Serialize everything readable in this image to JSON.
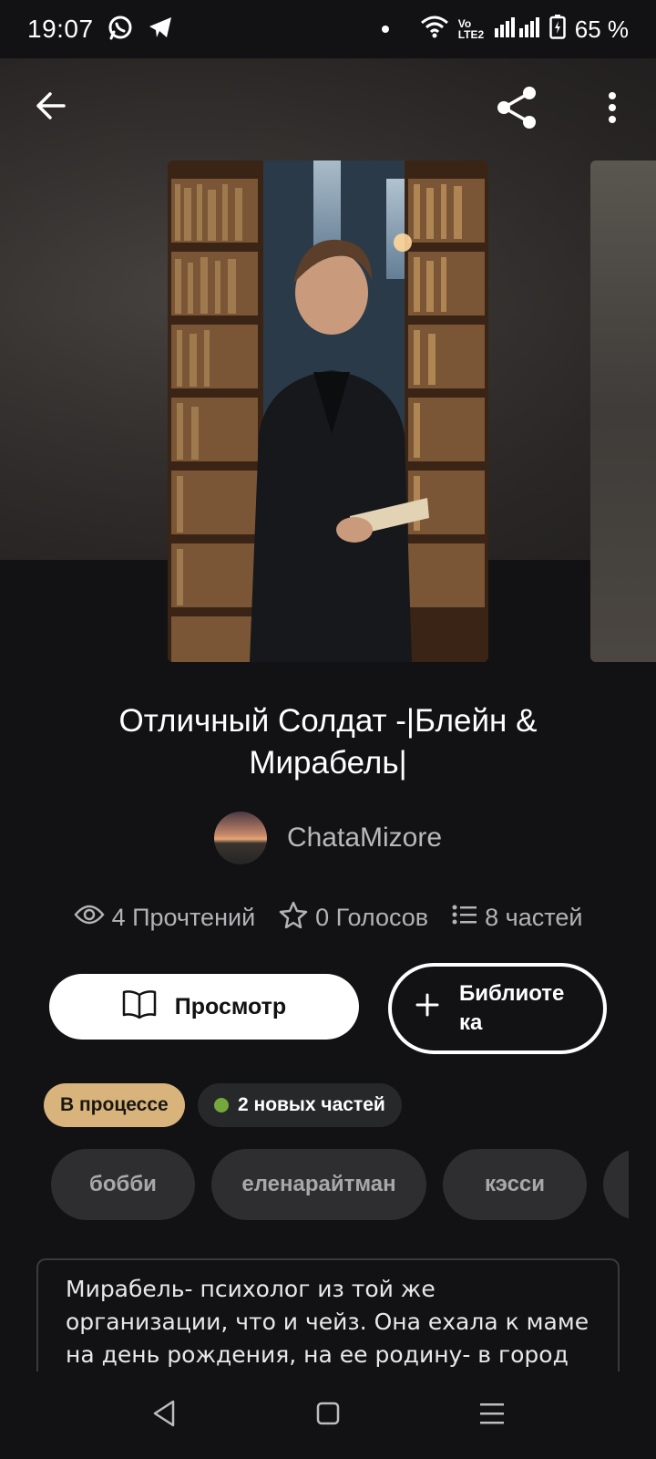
{
  "status_bar": {
    "time": "19:07",
    "network_label": "Vo LTE2",
    "battery": "65 %"
  },
  "book": {
    "title": "Отличный Солдат -|Блейн & Мирабель|",
    "author": "ChataMizore",
    "stats": {
      "reads": "4 Прочтений",
      "votes": "0 Голосов",
      "parts": "8 частей"
    }
  },
  "actions": {
    "read_label": "Просмотр",
    "library_label": "Библиоте ка"
  },
  "badges": {
    "status": "В процессе",
    "new_parts": "2 новых частей"
  },
  "tags": [
    "бобби",
    "еленарайтман",
    "кэсси",
    ""
  ],
  "description": "Мирабель- психолог из той же организации, что и чейз. Она ехала к маме на день рождения, на ее родину- в город Белфрост,",
  "icons": {
    "back": "arrow-left-icon",
    "share": "share-icon",
    "more": "more-vertical-icon",
    "reads": "eye-icon",
    "votes": "star-icon",
    "parts": "list-icon",
    "read": "book-open-icon",
    "library": "plus-icon"
  },
  "colors": {
    "background": "#121113",
    "status_badge": "#d8b47c",
    "new_dot": "#74a83c",
    "tag_bg": "#2e2e31"
  }
}
